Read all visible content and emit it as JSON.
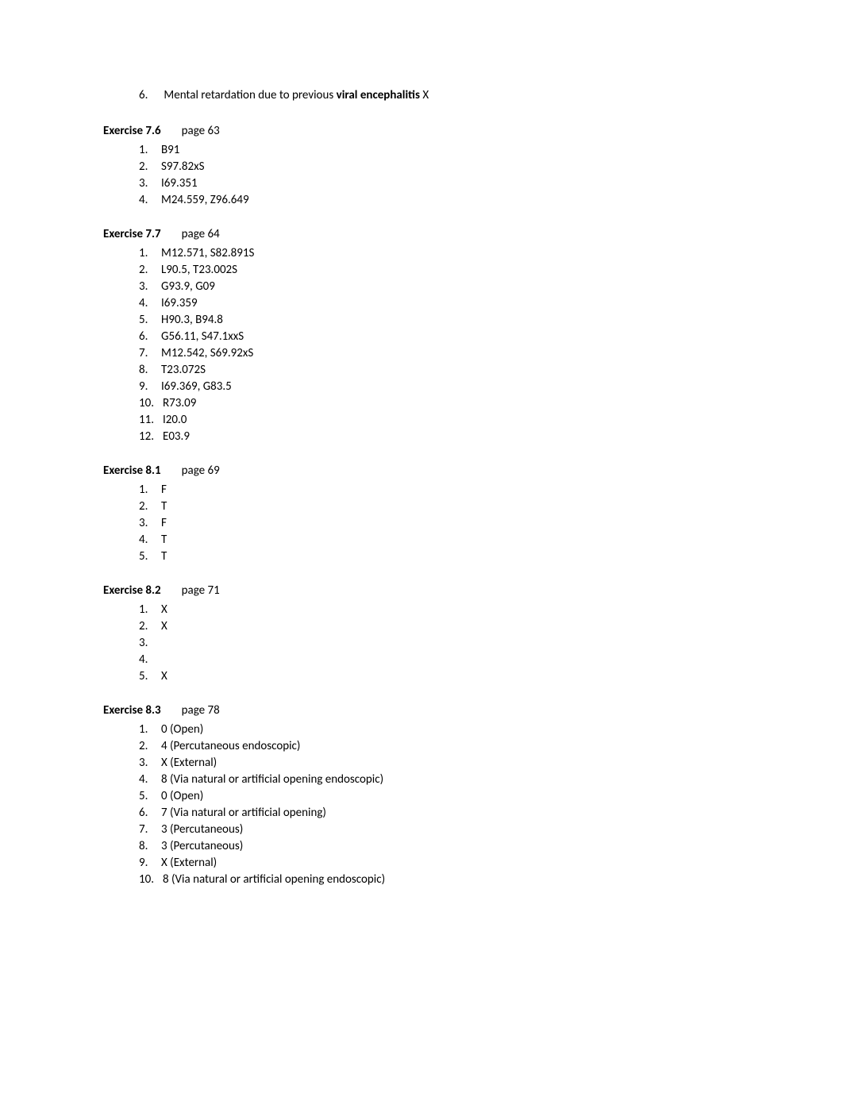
{
  "leading_item": {
    "number": "6.",
    "text_before": "Mental retardation due to previous ",
    "text_bold": "viral encephalitis",
    "text_after": " X"
  },
  "exercises": [
    {
      "title": "Exercise 7.6",
      "page": "page 63",
      "items": [
        {
          "n": "1.",
          "v": "B91"
        },
        {
          "n": "2.",
          "v": "S97.82xS"
        },
        {
          "n": "3.",
          "v": "I69.351"
        },
        {
          "n": "4.",
          "v": "M24.559, Z96.649"
        }
      ]
    },
    {
      "title": "Exercise 7.7",
      "page": "page 64",
      "items": [
        {
          "n": "1.",
          "v": "M12.571, S82.891S"
        },
        {
          "n": "2.",
          "v": "L90.5, T23.002S"
        },
        {
          "n": "3.",
          "v": "G93.9, G09"
        },
        {
          "n": "4.",
          "v": "I69.359"
        },
        {
          "n": "5.",
          "v": "H90.3, B94.8"
        },
        {
          "n": "6.",
          "v": "G56.11, S47.1xxS"
        },
        {
          "n": "7.",
          "v": "M12.542, S69.92xS"
        },
        {
          "n": "8.",
          "v": "T23.072S"
        },
        {
          "n": "9.",
          "v": "I69.369, G83.5"
        },
        {
          "n": "10.",
          "v": "R73.09"
        },
        {
          "n": "11.",
          "v": "I20.0"
        },
        {
          "n": "12.",
          "v": "E03.9"
        }
      ]
    },
    {
      "title": "Exercise 8.1",
      "page": "page 69",
      "items": [
        {
          "n": "1.",
          "v": "F"
        },
        {
          "n": "2.",
          "v": "T"
        },
        {
          "n": "3.",
          "v": "F"
        },
        {
          "n": "4.",
          "v": "T"
        },
        {
          "n": "5.",
          "v": "T"
        }
      ]
    },
    {
      "title": "Exercise 8.2",
      "page": "page 71",
      "items": [
        {
          "n": "1.",
          "v": "X"
        },
        {
          "n": "2.",
          "v": "X"
        },
        {
          "n": "3.",
          "v": ""
        },
        {
          "n": "4.",
          "v": ""
        },
        {
          "n": "5.",
          "v": "X"
        }
      ]
    },
    {
      "title": "Exercise 8.3",
      "page": "page 78",
      "items": [
        {
          "n": "1.",
          "v": "0 (Open)"
        },
        {
          "n": "2.",
          "v": "4 (Percutaneous endoscopic)"
        },
        {
          "n": "3.",
          "v": "X (External)"
        },
        {
          "n": "4.",
          "v": "8 (Via natural or artificial opening endoscopic)"
        },
        {
          "n": "5.",
          "v": "0 (Open)"
        },
        {
          "n": "6.",
          "v": "7 (Via natural or artificial opening)"
        },
        {
          "n": "7.",
          "v": "3 (Percutaneous)"
        },
        {
          "n": "8.",
          "v": "3 (Percutaneous)"
        },
        {
          "n": "9.",
          "v": "X (External)"
        },
        {
          "n": "10.",
          "v": "8 (Via natural or artificial opening endoscopic)"
        }
      ]
    }
  ]
}
